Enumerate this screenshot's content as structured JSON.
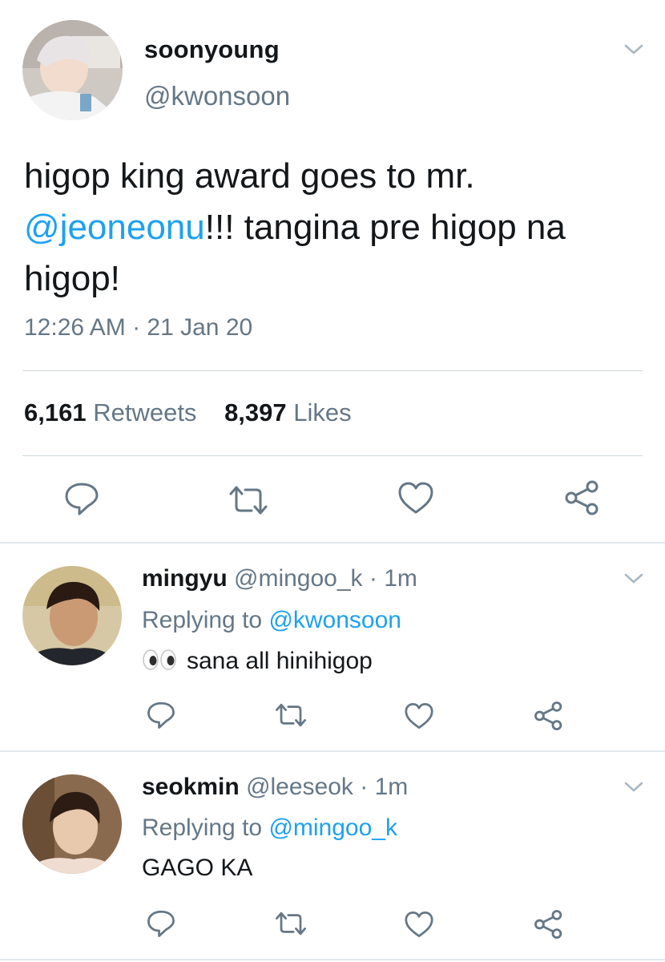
{
  "colors": {
    "link": "#1da1f2",
    "muted": "#657786",
    "text": "#14171a",
    "divider": "#e1e8ed"
  },
  "main_tweet": {
    "name": "soonyoung",
    "handle": "@kwonsoon",
    "text_line1": "higop king award goes to mr.",
    "mention": "@jeoneonu",
    "text_line2_rest": "!!! tangina pre higop na",
    "text_line3": "higop!",
    "timestamp": "12:26 AM · 21 Jan 20",
    "retweets_count": "6,161",
    "retweets_label": "Retweets",
    "likes_count": "8,397",
    "likes_label": "Likes",
    "actions": [
      "reply-icon",
      "retweet-icon",
      "like-icon",
      "share-icon"
    ]
  },
  "replies": [
    {
      "name": "mingyu",
      "handle": "@mingoo_k",
      "time": "· 1m",
      "replying_label": "Replying to",
      "replying_to": "@kwonsoon",
      "emoji": "eyes-emoji",
      "text": "sana all hinihigop"
    },
    {
      "name": "seokmin",
      "handle": "@leeseok",
      "time": "· 1m",
      "replying_label": "Replying to",
      "replying_to": "@mingoo_k",
      "text": "GAGO KA"
    }
  ]
}
